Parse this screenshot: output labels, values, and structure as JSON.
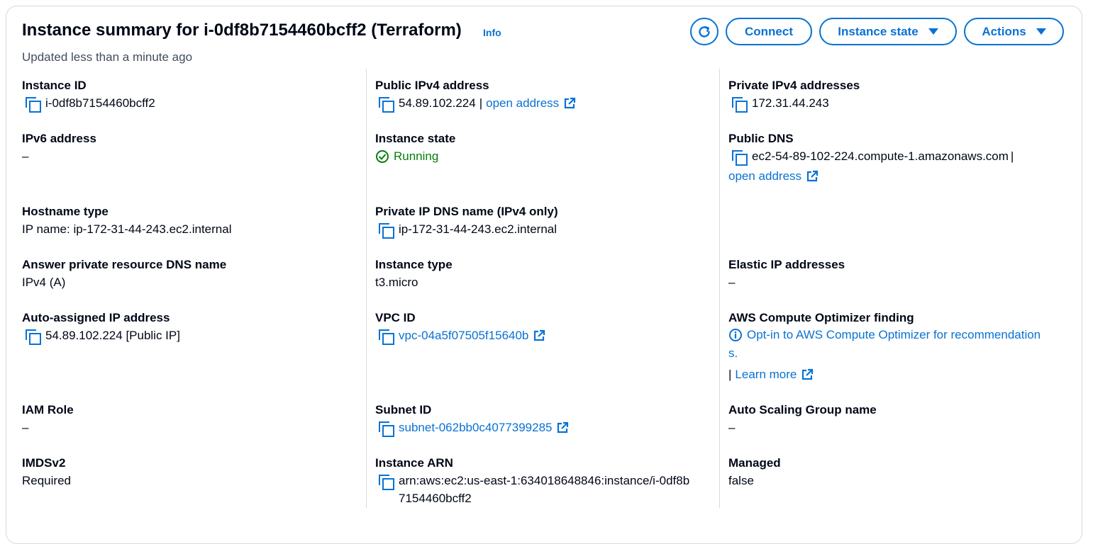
{
  "header": {
    "title": "Instance summary for i-0df8b7154460bcff2 (Terraform)",
    "info": "Info",
    "updated": "Updated less than a minute ago",
    "connect": "Connect",
    "instance_state": "Instance state",
    "actions": "Actions"
  },
  "col1": {
    "instance_id_label": "Instance ID",
    "instance_id": "i-0df8b7154460bcff2",
    "ipv6_label": "IPv6 address",
    "ipv6": "–",
    "hostname_label": "Hostname type",
    "hostname": "IP name: ip-172-31-44-243.ec2.internal",
    "answer_dns_label": "Answer private resource DNS name",
    "answer_dns": "IPv4 (A)",
    "auto_ip_label": "Auto-assigned IP address",
    "auto_ip": "54.89.102.224 [Public IP]",
    "iam_label": "IAM Role",
    "iam": "–",
    "imds_label": "IMDSv2",
    "imds": "Required"
  },
  "col2": {
    "public_ipv4_label": "Public IPv4 address",
    "public_ipv4": "54.89.102.224",
    "public_ipv4_sep": "|",
    "open_address": "open address",
    "state_label": "Instance state",
    "state": "Running",
    "private_dns_label": "Private IP DNS name (IPv4 only)",
    "private_dns": "ip-172-31-44-243.ec2.internal",
    "type_label": "Instance type",
    "type": "t3.micro",
    "vpc_label": "VPC ID",
    "vpc": "vpc-04a5f07505f15640b",
    "subnet_label": "Subnet ID",
    "subnet": "subnet-062bb0c4077399285",
    "arn_label": "Instance ARN",
    "arn_line1": "arn:aws:ec2:us-east-1:634018648846:instance/i-0df8b",
    "arn_line2": "7154460bcff2"
  },
  "col3": {
    "private_ipv4_label": "Private IPv4 addresses",
    "private_ipv4": "172.31.44.243",
    "public_dns_label": "Public DNS",
    "public_dns": "ec2-54-89-102-224.compute-1.amazonaws.com",
    "public_dns_sep": "|",
    "open_address": "open address",
    "elastic_label": "Elastic IP addresses",
    "elastic": "–",
    "optimizer_label": "AWS Compute Optimizer finding",
    "optimizer_link_line1": "Opt-in to AWS Compute Optimizer for recommendation",
    "optimizer_link_line2": "s.",
    "optimizer_sep": "|",
    "learn_more": "Learn more",
    "asg_label": "Auto Scaling Group name",
    "asg": "–",
    "managed_label": "Managed",
    "managed": "false"
  }
}
